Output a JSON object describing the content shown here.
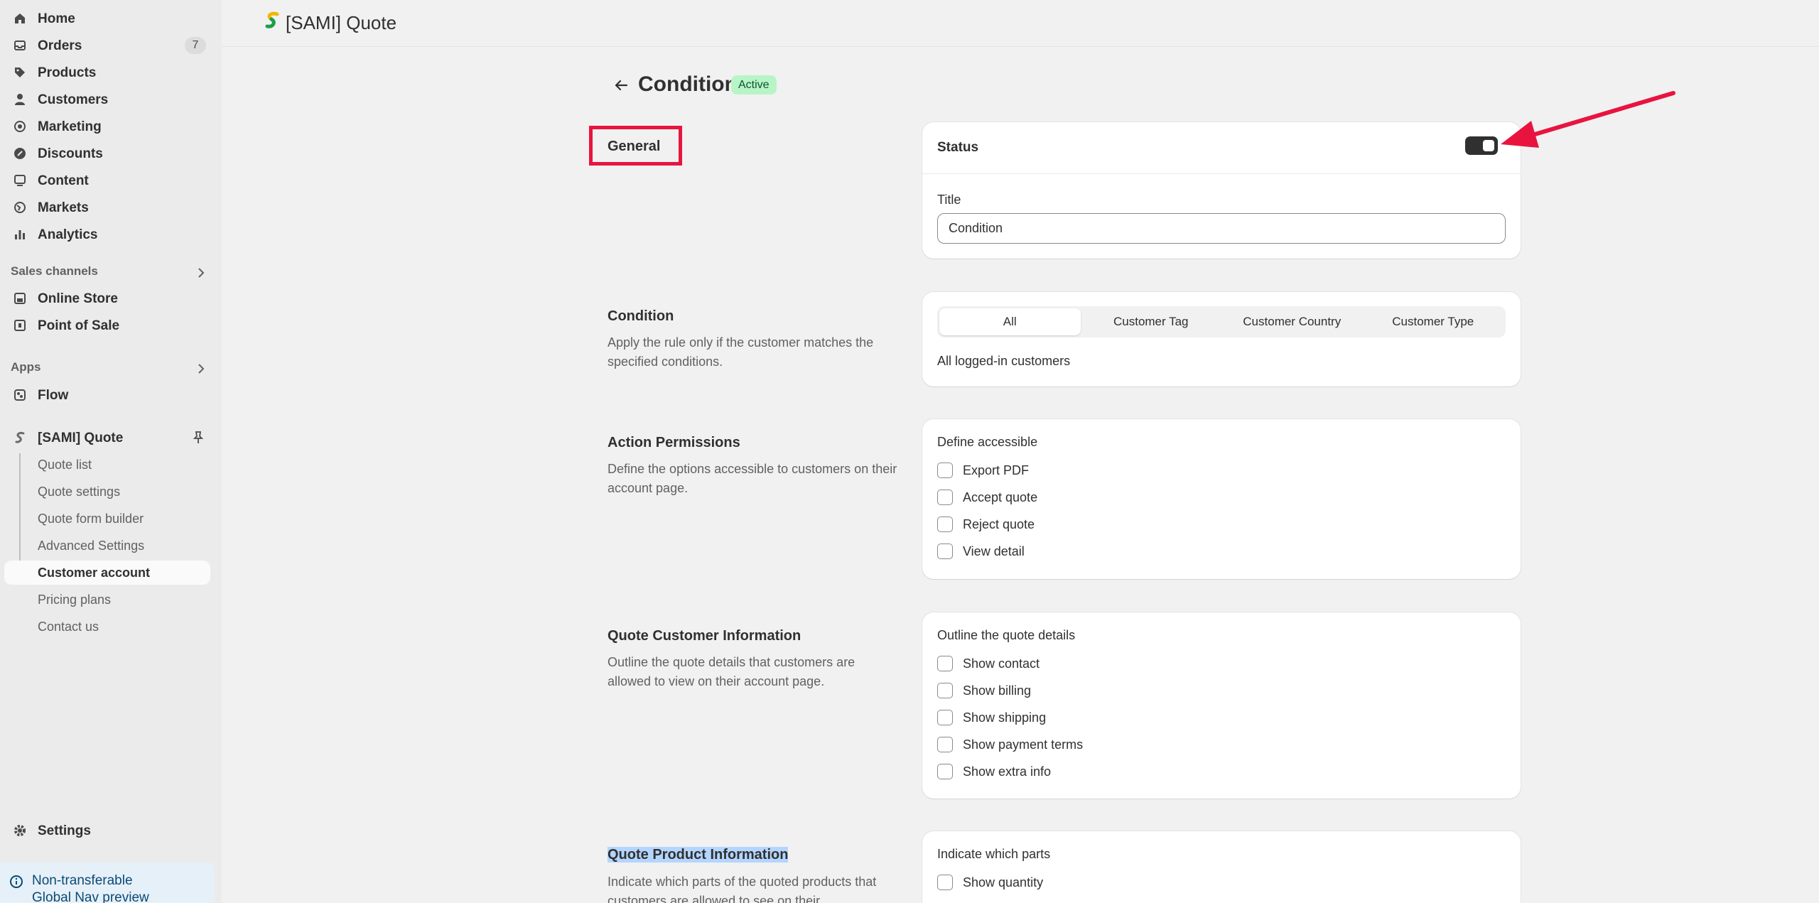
{
  "sidebar": {
    "items": [
      {
        "label": "Home"
      },
      {
        "label": "Orders",
        "badge": "7"
      },
      {
        "label": "Products"
      },
      {
        "label": "Customers"
      },
      {
        "label": "Marketing"
      },
      {
        "label": "Discounts"
      },
      {
        "label": "Content"
      },
      {
        "label": "Markets"
      },
      {
        "label": "Analytics"
      }
    ],
    "sales_channels": {
      "title": "Sales channels",
      "items": [
        {
          "label": "Online Store"
        },
        {
          "label": "Point of Sale"
        }
      ]
    },
    "apps": {
      "title": "Apps",
      "items": [
        {
          "label": "Flow"
        }
      ]
    },
    "app": {
      "label": "[SAMI] Quote",
      "subitems": [
        {
          "label": "Quote list"
        },
        {
          "label": "Quote settings"
        },
        {
          "label": "Quote form builder"
        },
        {
          "label": "Advanced Settings"
        },
        {
          "label": "Customer account"
        },
        {
          "label": "Pricing plans"
        },
        {
          "label": "Contact us"
        }
      ]
    },
    "settings": "Settings",
    "notice": {
      "line1": "Non-transferable",
      "line2": "Global Nav preview"
    }
  },
  "header": {
    "title": "[SAMI] Quote"
  },
  "page": {
    "title": "Condition",
    "status": "Active"
  },
  "sections": {
    "general": {
      "title": "General",
      "status_label": "Status",
      "status_on": true,
      "title_label": "Title",
      "title_value": "Condition"
    },
    "condition": {
      "title": "Condition",
      "desc": "Apply the rule only if the customer matches the specified conditions.",
      "tabs": [
        "All",
        "Customer Tag",
        "Customer Country",
        "Customer Type"
      ],
      "selected_tab": "All",
      "result": "All logged-in customers"
    },
    "action_permissions": {
      "title": "Action Permissions",
      "desc": "Define the options accessible to customers on their account page.",
      "heading": "Define accessible",
      "options": [
        "Export PDF",
        "Accept quote",
        "Reject quote",
        "View detail"
      ]
    },
    "quote_customer": {
      "title": "Quote Customer Information",
      "desc": "Outline the quote details that customers are allowed to view on their account page.",
      "heading": "Outline the quote details",
      "options": [
        "Show contact",
        "Show billing",
        "Show shipping",
        "Show payment terms",
        "Show extra info"
      ]
    },
    "quote_product": {
      "title": "Quote Product Information",
      "desc": "Indicate which parts of the quoted products that customers are allowed to see on their",
      "heading": "Indicate which parts",
      "options": [
        "Show quantity"
      ]
    }
  },
  "colors": {
    "annotation": "#e8143f",
    "badge_active_bg": "#b8f5c6",
    "sidebar_bg": "#ebebeb",
    "page_bg": "#f1f1f1"
  }
}
